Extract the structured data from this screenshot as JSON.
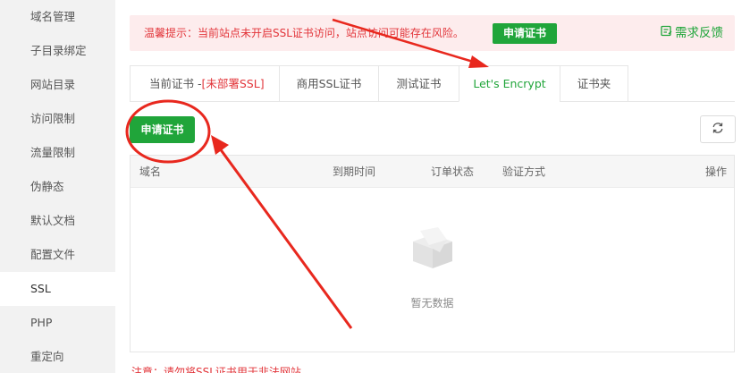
{
  "sidebar": {
    "items": [
      {
        "label": "域名管理"
      },
      {
        "label": "子目录绑定"
      },
      {
        "label": "网站目录"
      },
      {
        "label": "访问限制"
      },
      {
        "label": "流量限制"
      },
      {
        "label": "伪静态"
      },
      {
        "label": "默认文档"
      },
      {
        "label": "配置文件"
      },
      {
        "label": "SSL",
        "active": true
      },
      {
        "label": "PHP"
      },
      {
        "label": "重定向"
      }
    ]
  },
  "tip": {
    "text": "温馨提示：当前站点未开启SSL证书访问，站点访问可能存在风险。",
    "button_label": "申请证书",
    "feedback_label": "需求反馈",
    "feedback_icon": "feedback-icon"
  },
  "tabs": {
    "current_prefix": "当前证书 -",
    "current_status": "[未部署SSL]",
    "business": "商用SSL证书",
    "test": "测试证书",
    "letsencrypt": "Let's Encrypt",
    "folder": "证书夹",
    "active": "letsencrypt"
  },
  "toolbar": {
    "apply_label": "申请证书",
    "refresh_icon": "refresh-icon"
  },
  "table": {
    "columns": [
      "域名",
      "到期时间",
      "订单状态",
      "验证方式",
      "操作"
    ],
    "rows": [],
    "empty_text": "暂无数据",
    "empty_icon": "empty-box-icon"
  },
  "note": {
    "text": "注意：请勿将SSL证书用于非法网站"
  },
  "colors": {
    "accent": "#20a53a",
    "danger": "#e2353a",
    "tip_bg": "#fdeced",
    "annotation": "#e8281e"
  }
}
